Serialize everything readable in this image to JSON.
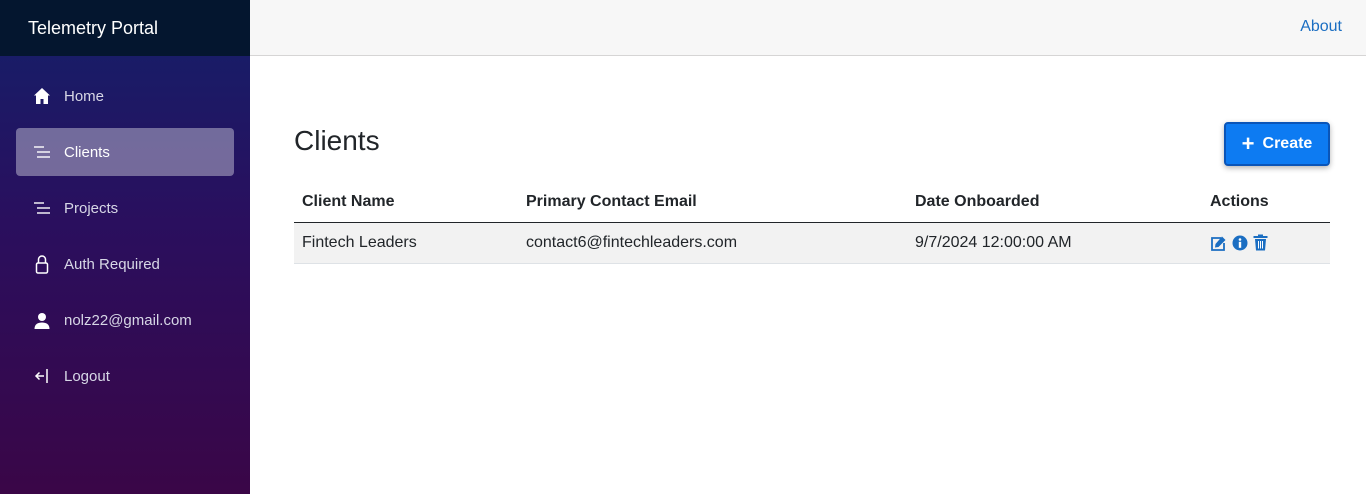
{
  "app": {
    "title": "Telemetry Portal"
  },
  "topbar": {
    "about_label": "About"
  },
  "sidebar": {
    "items": [
      {
        "label": "Home",
        "icon": "home-icon",
        "active": false
      },
      {
        "label": "Clients",
        "icon": "list-icon",
        "active": true
      },
      {
        "label": "Projects",
        "icon": "list-icon",
        "active": false
      },
      {
        "label": "Auth Required",
        "icon": "lock-icon",
        "active": false
      },
      {
        "label": "nolz22@gmail.com",
        "icon": "person-icon",
        "active": false
      },
      {
        "label": "Logout",
        "icon": "logout-icon",
        "active": false
      }
    ]
  },
  "page": {
    "title": "Clients",
    "create_label": "Create"
  },
  "table": {
    "columns": [
      "Client Name",
      "Primary Contact Email",
      "Date Onboarded",
      "Actions"
    ],
    "rows": [
      {
        "client_name": "Fintech Leaders",
        "email": "contact6@fintechleaders.com",
        "date_onboarded": "9/7/2024 12:00:00 AM",
        "actions": [
          "edit-icon",
          "info-icon",
          "trash-icon"
        ]
      }
    ]
  },
  "colors": {
    "accent": "#1b6ec2",
    "create_button": "#0d7bf2",
    "sidebar_top": "#13206a",
    "sidebar_bottom": "#3a0647"
  }
}
